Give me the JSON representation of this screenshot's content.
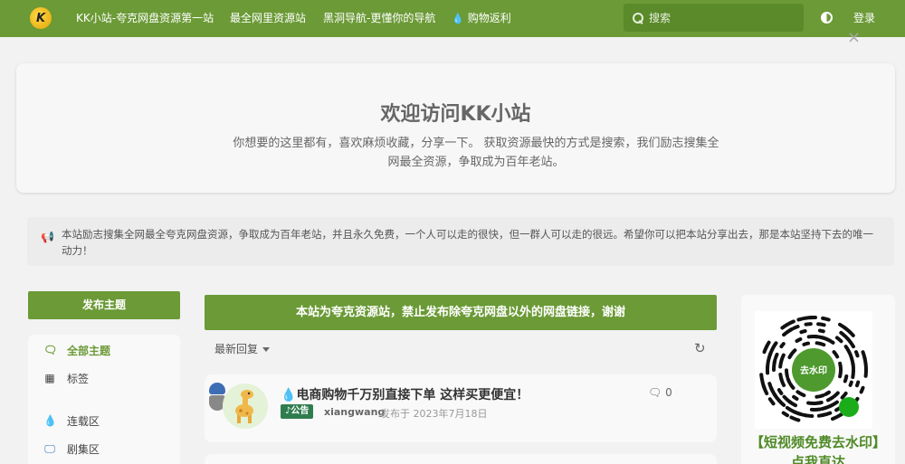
{
  "nav": {
    "logo_letter": "K",
    "links": [
      {
        "label": "KK小站-夸克网盘资源第一站"
      },
      {
        "label": "最全网里资源站"
      },
      {
        "label": "黑洞导航-更懂你的导航"
      },
      {
        "label": "购物返利",
        "icon": "fire-icon"
      }
    ],
    "search_placeholder": "搜索",
    "login_label": "登录"
  },
  "welcome": {
    "title": "欢迎访问KK小站",
    "description": "你想要的这里都有，喜欢麻烦收藏，分享一下。 获取资源最快的方式是搜索，我们励志搜集全网最全资源，争取成为百年老站。",
    "close_glyph": "×"
  },
  "notice": {
    "text": "本站励志搜集全网最全夸克网盘资源，争取成为百年老站，并且永久免费，一个人可以走的很快，但一群人可以走的很远。希望你可以把本站分享出去，那是本站坚持下去的唯一动力！"
  },
  "sidebar": {
    "publish_label": "发布主题",
    "items": [
      {
        "label": "全部主题",
        "icon": "chat-icon",
        "active": true
      },
      {
        "label": "标签",
        "icon": "grid-icon",
        "active": false
      },
      {
        "label": "连载区",
        "icon": "fire-icon",
        "active": false
      },
      {
        "label": "剧集区",
        "icon": "monitor-icon",
        "active": false
      }
    ]
  },
  "main": {
    "banner": "本站为夸克资源站，禁止发布除夸克网盘以外的网盘链接，谢谢",
    "sort_label": "最新回复",
    "posts": [
      {
        "title": "电商购物千万别直接下单 这样买更便宜！",
        "title_icon": "fire-icon",
        "tag": "公告",
        "author": "xiangwang",
        "time": "发布于 2023年7月18日",
        "comments": "0"
      }
    ]
  },
  "widget": {
    "caption_line1": "【短视频免费去水印】",
    "caption_line2": "点我直达",
    "qr_center_text": "去水印"
  },
  "colors": {
    "brand_green": "#6b9a36",
    "tag_green": "#2f7d4f"
  }
}
